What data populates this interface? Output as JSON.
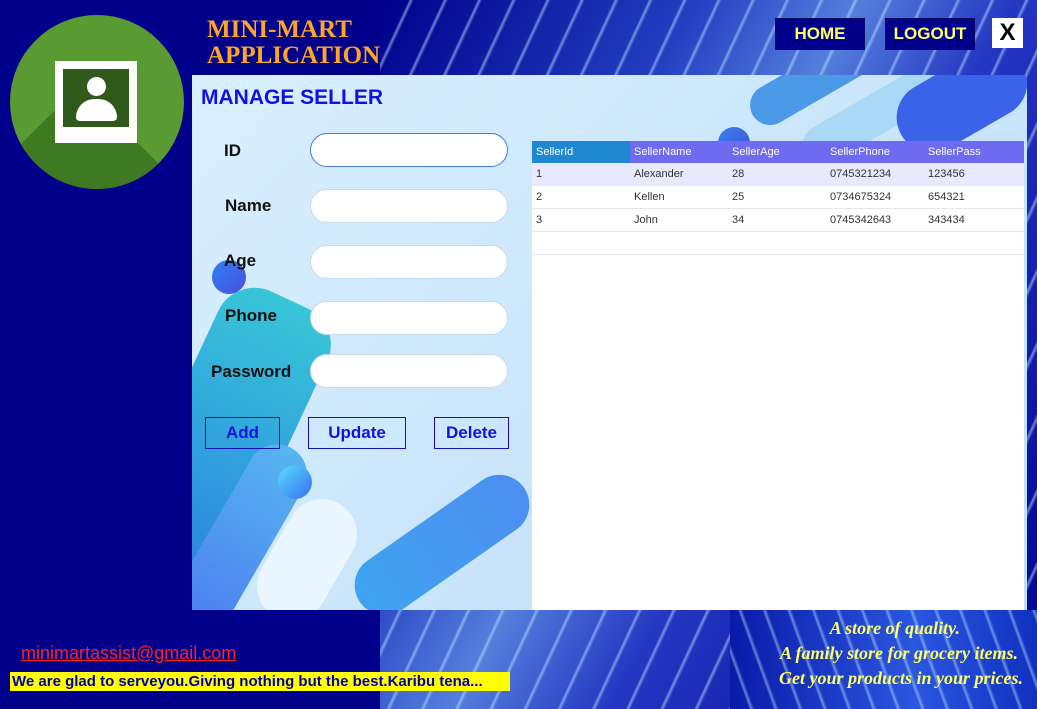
{
  "app": {
    "title_line1": "MINI-MART",
    "title_line2": "APPLICATION"
  },
  "nav": {
    "home_label": "HOME",
    "logout_label": "LOGOUT",
    "close_label": "X"
  },
  "form": {
    "title": "MANAGE SELLER",
    "fields": [
      {
        "label": "ID",
        "value": ""
      },
      {
        "label": "Name",
        "value": ""
      },
      {
        "label": "Age",
        "value": ""
      },
      {
        "label": "Phone",
        "value": ""
      },
      {
        "label": "Password",
        "value": ""
      }
    ],
    "buttons": {
      "add": "Add",
      "update": "Update",
      "delete": "Delete"
    }
  },
  "grid": {
    "columns": [
      "SellerId",
      "SellerName",
      "SellerAge",
      "SellerPhone",
      "SellerPass"
    ],
    "rows": [
      [
        "1",
        "Alexander",
        "28",
        "0745321234",
        "123456"
      ],
      [
        "2",
        "Kellen",
        "25",
        "0734675324",
        "654321"
      ],
      [
        "3",
        "John",
        "34",
        "0745342643",
        "343434"
      ]
    ]
  },
  "footer": {
    "email": "minimartassist@gmail.com",
    "marquee": "We are glad to serveyou.Giving nothing but the best.Karibu tena...",
    "taglines": [
      "A store of quality.",
      "A family store for grocery items.",
      "Get your products in your prices."
    ]
  },
  "colors": {
    "window_bg": "#00008b",
    "title_orange": "#ffa626",
    "nav_text": "#ffff66",
    "accent_blue": "#1212e0",
    "grid_header": "#6f6bf0",
    "grid_header_first": "#1e88d0",
    "email_red": "#ff2020",
    "marquee_bg": "#ffff00"
  },
  "icons": {
    "avatar": "user-photo-icon"
  }
}
